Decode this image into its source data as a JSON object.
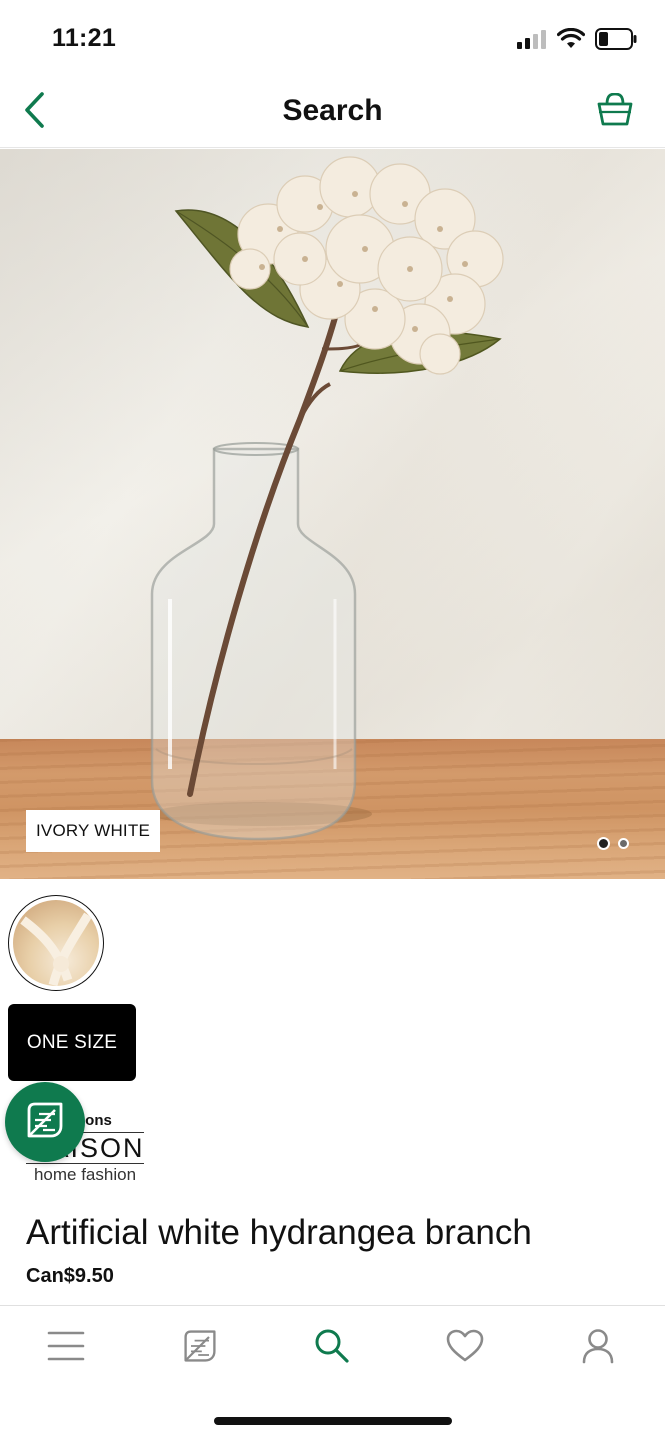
{
  "status_bar": {
    "time": "11:21"
  },
  "header": {
    "title": "Search",
    "back_icon": "chevron-left-icon",
    "bag_icon": "shopping-bag-icon"
  },
  "colors": {
    "accent": "#0f7a4e",
    "text": "#111111",
    "nav_gray": "#8a8a8a"
  },
  "gallery": {
    "color_label": "IVORY WHITE",
    "page_count": 2,
    "current_page": 1
  },
  "variant": {
    "size_label": "ONE SIZE"
  },
  "brand": {
    "top_text": "hons",
    "name": "MAISON",
    "subtitle": "home fashion"
  },
  "product": {
    "name": "Artificial white hydrangea branch",
    "price": "Can$9.50"
  },
  "bottom_nav": {
    "items": [
      {
        "id": "menu",
        "icon": "menu-icon"
      },
      {
        "id": "sustainability",
        "icon": "leaf-icon"
      },
      {
        "id": "search",
        "icon": "search-icon",
        "active": true
      },
      {
        "id": "wishlist",
        "icon": "heart-icon"
      },
      {
        "id": "account",
        "icon": "user-icon"
      }
    ]
  }
}
